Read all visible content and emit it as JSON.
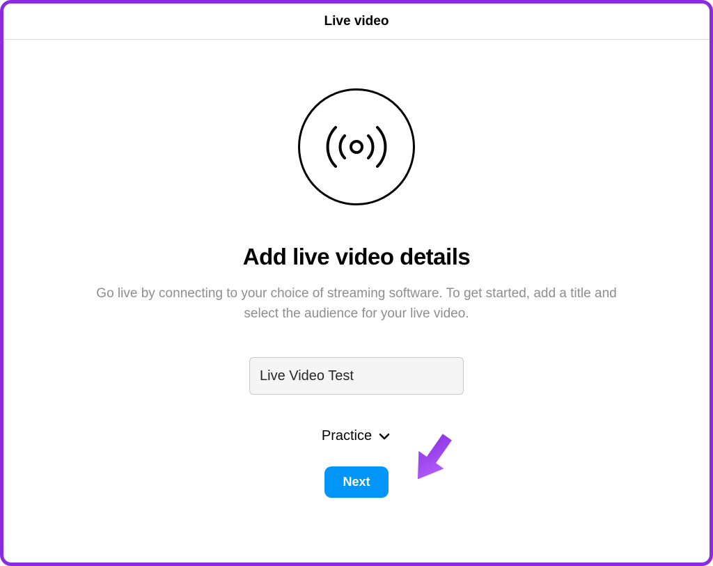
{
  "header": {
    "title": "Live video"
  },
  "main": {
    "heading": "Add live video details",
    "description": "Go live by connecting to your choice of streaming software. To get started, add a title and select the audience for your live video.",
    "title_input_value": "Live Video Test",
    "audience": {
      "label": "Practice"
    },
    "next_label": "Next"
  }
}
